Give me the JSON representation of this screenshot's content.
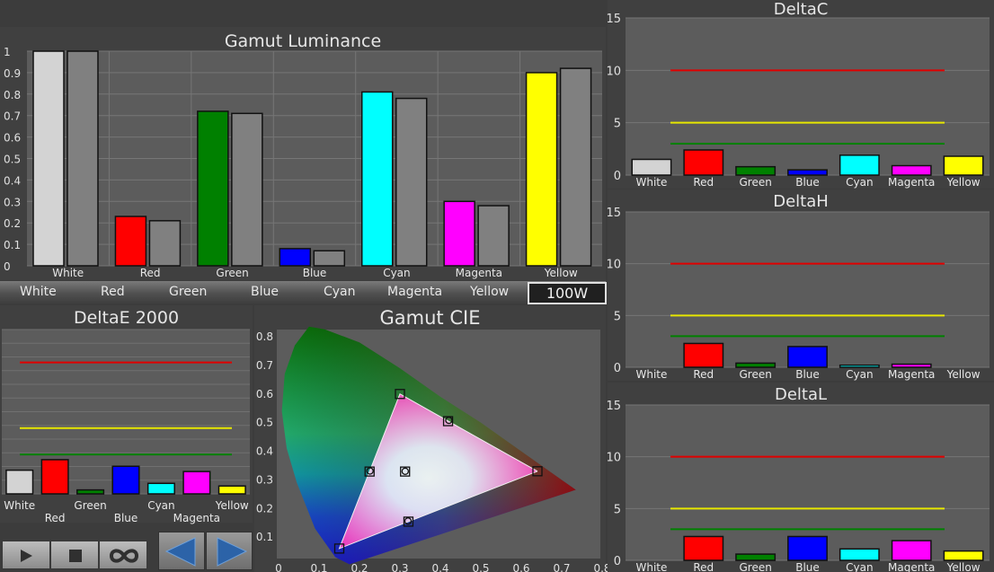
{
  "colors": {
    "White": "#d3d3d3",
    "Red": "#ff0000",
    "Green": "#008000",
    "Blue": "#0000ff",
    "Cyan": "#00ffff",
    "Magenta": "#ff00ff",
    "Yellow": "#ffff00",
    "measured": "#808080",
    "panel_bg": "#5c5c5c",
    "red_line": "#e00000",
    "yellow_line": "#e6e600",
    "green_line": "#008000"
  },
  "selector": {
    "items": [
      "White",
      "Red",
      "Green",
      "Blue",
      "Cyan",
      "Magenta",
      "Yellow"
    ],
    "selected": "100W"
  },
  "controls": {
    "play": "play-icon",
    "stop": "stop-icon",
    "loop": "infinity-icon",
    "prev": "arrow-left-icon",
    "next": "arrow-right-icon"
  },
  "chart_data": [
    {
      "id": "gamut_luminance",
      "type": "bar",
      "title": "Gamut Luminance",
      "categories": [
        "White",
        "Red",
        "Green",
        "Blue",
        "Cyan",
        "Magenta",
        "Yellow"
      ],
      "series": [
        {
          "values": [
            1.0,
            0.23,
            0.72,
            0.08,
            0.81,
            0.3,
            0.9
          ]
        },
        {
          "values": [
            1.0,
            0.21,
            0.71,
            0.07,
            0.78,
            0.28,
            0.92
          ]
        }
      ],
      "ylim": [
        0,
        1
      ],
      "yticks": [
        "0",
        "0.1",
        "0.2",
        "0.3",
        "0.4",
        "0.5",
        "0.6",
        "0.7",
        "0.8",
        "0.9",
        "1"
      ],
      "grid": true
    },
    {
      "id": "deltac",
      "type": "bar",
      "title": "DeltaC",
      "categories": [
        "White",
        "Red",
        "Green",
        "Blue",
        "Cyan",
        "Magenta",
        "Yellow"
      ],
      "values": [
        1.5,
        2.4,
        0.8,
        0.5,
        1.9,
        0.9,
        1.8
      ],
      "ylim": [
        0,
        15
      ],
      "yticks": [
        "0",
        "5",
        "10",
        "15"
      ],
      "thresholds": [
        10,
        5,
        3
      ]
    },
    {
      "id": "deltah",
      "type": "bar",
      "title": "DeltaH",
      "categories": [
        "White",
        "Red",
        "Green",
        "Blue",
        "Cyan",
        "Magenta",
        "Yellow"
      ],
      "values": [
        0,
        2.3,
        0.4,
        2.0,
        0.2,
        0.3,
        0
      ],
      "ylim": [
        0,
        15
      ],
      "yticks": [
        "0",
        "5",
        "10",
        "15"
      ],
      "thresholds": [
        10,
        5,
        3
      ]
    },
    {
      "id": "deltal",
      "type": "bar",
      "title": "DeltaL",
      "categories": [
        "White",
        "Red",
        "Green",
        "Blue",
        "Cyan",
        "Magenta",
        "Yellow"
      ],
      "values": [
        0,
        2.3,
        0.6,
        2.3,
        1.1,
        1.9,
        0.9
      ],
      "ylim": [
        0,
        15
      ],
      "yticks": [
        "0",
        "5",
        "10",
        "15"
      ],
      "thresholds": [
        10,
        5,
        3
      ]
    },
    {
      "id": "deltae2000",
      "type": "bar",
      "title": "DeltaE 2000",
      "categories": [
        "White",
        "Red",
        "Green",
        "Blue",
        "Cyan",
        "Magenta",
        "Yellow"
      ],
      "values": [
        1.8,
        2.6,
        0.3,
        2.1,
        0.8,
        1.7,
        0.6
      ],
      "thresholds": [
        10,
        5,
        3
      ]
    },
    {
      "id": "gamut_cie",
      "type": "scatter",
      "title": "Gamut CIE",
      "xlim": [
        0,
        0.8
      ],
      "ylim": [
        0,
        0.8
      ],
      "xticks": [
        "0",
        "0.1",
        "0.2",
        "0.3",
        "0.4",
        "0.5",
        "0.6",
        "0.7",
        "0.8"
      ],
      "yticks": [
        "0.1",
        "0.2",
        "0.3",
        "0.4",
        "0.5",
        "0.6",
        "0.7",
        "0.8"
      ],
      "target": [
        {
          "x": 0.64,
          "y": 0.33
        },
        {
          "x": 0.3,
          "y": 0.6
        },
        {
          "x": 0.15,
          "y": 0.06
        },
        {
          "x": 0.225,
          "y": 0.329
        },
        {
          "x": 0.321,
          "y": 0.154
        },
        {
          "x": 0.419,
          "y": 0.505
        },
        {
          "x": 0.3127,
          "y": 0.329
        }
      ],
      "measured": [
        {
          "x": 0.642,
          "y": 0.331
        },
        {
          "x": 0.303,
          "y": 0.598
        },
        {
          "x": 0.152,
          "y": 0.063
        },
        {
          "x": 0.226,
          "y": 0.331
        },
        {
          "x": 0.32,
          "y": 0.156
        },
        {
          "x": 0.421,
          "y": 0.508
        },
        {
          "x": 0.313,
          "y": 0.33
        }
      ]
    }
  ]
}
